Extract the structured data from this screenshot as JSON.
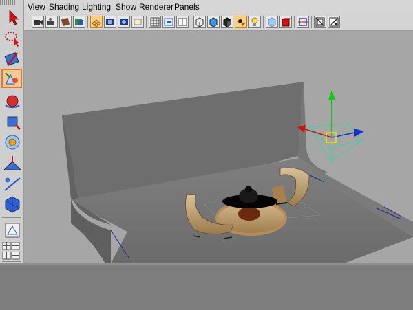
{
  "menubar": {
    "items": [
      {
        "label": "View"
      },
      {
        "label": "Shading"
      },
      {
        "label": "Lighting"
      },
      {
        "label": "Show"
      },
      {
        "label": "Renderer"
      },
      {
        "label": "Panels"
      }
    ]
  },
  "iconbar": {
    "icons": [
      "select-camera-icon",
      "camera-attributes-icon",
      "bookmark-icon",
      "image-plane-icon",
      "grid-icon",
      "film-gate-icon",
      "resolution-gate-icon",
      "safe-action-icon",
      "wireframe-icon",
      "smooth-shade-icon",
      "shaded-wireframe-icon",
      "bounding-box-icon",
      "textured-icon",
      "use-all-lights-icon",
      "shadows-icon",
      "xray-icon",
      "isolate-select-icon",
      "high-quality-icon",
      "frame-all-icon",
      "snapshot-icon"
    ]
  },
  "toolbox": {
    "tools": [
      "select-tool-icon",
      "lasso-tool-icon",
      "paint-select-tool-icon",
      "move-tool-icon",
      "rotate-tool-icon",
      "scale-tool-icon",
      "universal-manipulator-icon",
      "soft-modification-icon",
      "show-manipulator-icon",
      "last-tool-icon",
      "sculpt-icon"
    ],
    "active_tool": "move-tool-icon"
  },
  "colors": {
    "accent": "#e07a20",
    "manipulator_x": "#cc1111",
    "manipulator_y": "#11aa11",
    "manipulator_z": "#1133cc",
    "light_frame": "#3ad39a",
    "viewport_bg": "#a6a6a6"
  }
}
